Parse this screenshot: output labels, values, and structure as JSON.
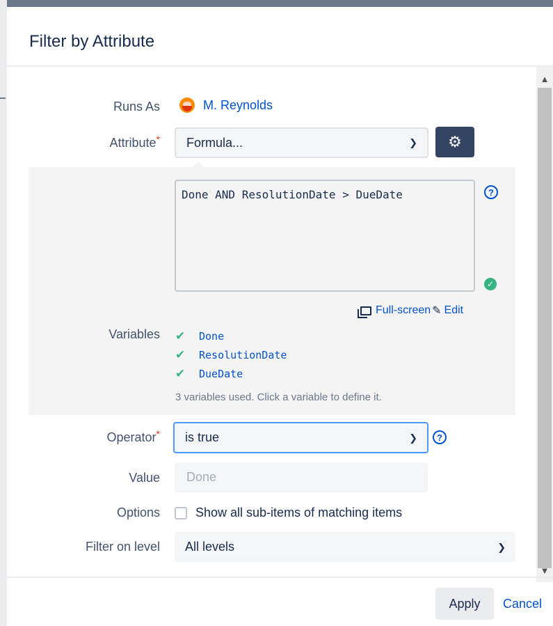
{
  "dialog": {
    "title": "Filter by Attribute"
  },
  "runs_as": {
    "label": "Runs As",
    "user": "M. Reynolds"
  },
  "attribute": {
    "label": "Attribute",
    "required_mark": "*",
    "selected": "Formula..."
  },
  "formula": {
    "text": "Done AND ResolutionDate > DueDate",
    "fullscreen_label": "Full-screen",
    "edit_label": "Edit"
  },
  "variables": {
    "label": "Variables",
    "items": [
      "Done",
      "ResolutionDate",
      "DueDate"
    ],
    "hint": "3 variables used. Click a variable to define it."
  },
  "operator": {
    "label": "Operator",
    "required_mark": "*",
    "selected": "is true"
  },
  "value": {
    "label": "Value",
    "placeholder": "Done"
  },
  "options": {
    "label": "Options",
    "checkbox_label": "Show all sub-items of matching items",
    "checked": false
  },
  "filter_level": {
    "label": "Filter on level",
    "selected": "All levels"
  },
  "footer": {
    "apply_label": "Apply",
    "cancel_label": "Cancel"
  },
  "colors": {
    "primary": "#0052cc",
    "dark_button": "#344563",
    "success": "#36b37e",
    "required": "#de350b"
  },
  "icons": [
    "avatar",
    "chevron-down-icon",
    "gear-icon",
    "help-icon",
    "check-circle-icon",
    "fullscreen-icon",
    "pencil-icon",
    "check-icon",
    "scroll-up-arrow",
    "scroll-down-arrow"
  ]
}
